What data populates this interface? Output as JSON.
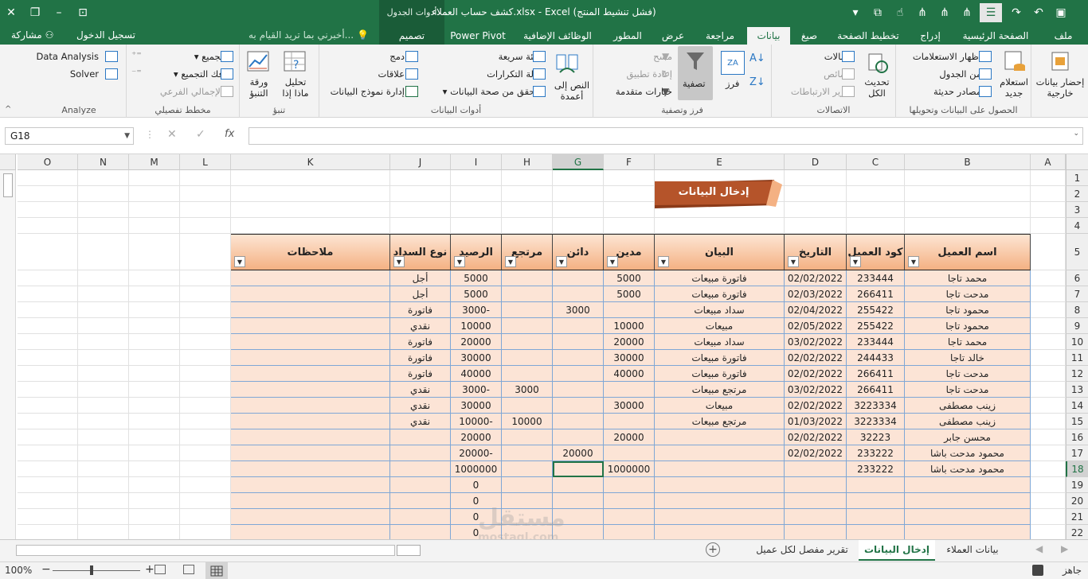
{
  "window": {
    "title": "كشف حساب العملاء.xlsx - Excel (فشل تنشيط المنتج)",
    "context_group_label": "أدوات الجدول"
  },
  "tabs": {
    "file": "ملف",
    "home": "الصفحة الرئيسية",
    "insert": "إدراج",
    "page_layout": "تخطيط الصفحة",
    "formulas": "صيغ",
    "data": "بيانات",
    "review": "مراجعة",
    "view": "عرض",
    "developer": "المطور",
    "addins": "الوظائف الإضافية",
    "power_pivot": "Power Pivot",
    "design": "تصميم",
    "tell_me": "أخبرني بما تريد القيام به...",
    "sign_in": "تسجيل الدخول",
    "share": "مشاركة"
  },
  "ribbon": {
    "get_external": "إحضار بيانات خارجية",
    "new_query": "استعلام جديد",
    "show_queries": "إظهار الاستعلامات",
    "from_table": "من الجدول",
    "recent_sources": "مصادر حديثة",
    "get_transform_label": "الحصول على البيانات وتحويلها",
    "refresh_all": "تحديث الكل",
    "connections": "اتصالات",
    "properties": "خصائص",
    "edit_links": "تحرير الارتباطات",
    "connections_label": "الاتصالات",
    "sort": "فرز",
    "filter": "تصفية",
    "clear": "مسح",
    "reapply": "إعادة تطبيق",
    "advanced": "خيارات متقدمة",
    "sort_filter_label": "فرز وتصفية",
    "text_to_columns": "النص إلى أعمدة",
    "flash_fill": "تعبئة سريعة",
    "remove_duplicates": "إزالة التكرارات",
    "data_validation": "التحقق من صحة البيانات",
    "consolidate": "دمج",
    "relationships": "علاقات",
    "manage_model": "إدارة نموذج البيانات",
    "data_tools_label": "أدوات البيانات",
    "what_if": "تحليل ماذا إذا",
    "forecast_sheet": "ورقة التنبؤ",
    "forecast_label": "تنبؤ",
    "group": "تجميع",
    "ungroup": "فك التجميع",
    "subtotal": "الإجمالي الفرعي",
    "outline_label": "مخطط تفصيلي",
    "data_analysis": "Data Analysis",
    "solver": "Solver",
    "analyze_label": "Analyze"
  },
  "formula_bar": {
    "name_box": "G18",
    "fx": "fx",
    "content": ""
  },
  "columns": [
    "O",
    "N",
    "M",
    "L",
    "K",
    "J",
    "I",
    "H",
    "G",
    "F",
    "E",
    "D",
    "C",
    "B",
    "A"
  ],
  "selected_column": "G",
  "rows": [
    "1",
    "2",
    "3",
    "4",
    "5",
    "6",
    "7",
    "8",
    "9",
    "10",
    "11",
    "12",
    "13",
    "14",
    "15",
    "16",
    "17",
    "18",
    "19",
    "20",
    "21",
    "22"
  ],
  "selected_row": "18",
  "banner": "إدخال البيانات",
  "table": {
    "headers": {
      "name": "اسم العميل",
      "code": "كود العميل",
      "date": "التاريخ",
      "desc": "البيان",
      "debit": "مدين",
      "credit": "دائن",
      "return": "مرتجع",
      "balance": "الرصيد",
      "pay_type": "نوع السداد",
      "notes": "ملاحظات"
    },
    "rows": [
      {
        "name": "محمد تاجا",
        "code": "233444",
        "date": "02/02/2022",
        "desc": "فاتورة مبيعات",
        "debit": "5000",
        "credit": "",
        "ret": "",
        "balance": "5000",
        "pay": "أجل",
        "notes": ""
      },
      {
        "name": "مدحت تاجا",
        "code": "266411",
        "date": "02/03/2022",
        "desc": "فاتورة مبيعات",
        "debit": "5000",
        "credit": "",
        "ret": "",
        "balance": "5000",
        "pay": "أجل",
        "notes": ""
      },
      {
        "name": "محمود تاجا",
        "code": "255422",
        "date": "02/04/2022",
        "desc": "سداد مبيعات",
        "debit": "",
        "credit": "3000",
        "ret": "",
        "balance": "3000-",
        "pay": "فاتورة",
        "notes": ""
      },
      {
        "name": "محمود تاجا",
        "code": "255422",
        "date": "02/05/2022",
        "desc": "مبيعات",
        "debit": "10000",
        "credit": "",
        "ret": "",
        "balance": "10000",
        "pay": "نقدي",
        "notes": ""
      },
      {
        "name": "محمد تاجا",
        "code": "233444",
        "date": "03/02/2022",
        "desc": "سداد مبيعات",
        "debit": "20000",
        "credit": "",
        "ret": "",
        "balance": "20000",
        "pay": "فاتورة",
        "notes": ""
      },
      {
        "name": "خالد تاجا",
        "code": "244433",
        "date": "02/02/2022",
        "desc": "فاتورة مبيعات",
        "debit": "30000",
        "credit": "",
        "ret": "",
        "balance": "30000",
        "pay": "فاتورة",
        "notes": ""
      },
      {
        "name": "مدحت تاجا",
        "code": "266411",
        "date": "02/02/2022",
        "desc": "فاتورة مبيعات",
        "debit": "40000",
        "credit": "",
        "ret": "",
        "balance": "40000",
        "pay": "فاتورة",
        "notes": ""
      },
      {
        "name": "مدحت تاجا",
        "code": "266411",
        "date": "03/02/2022",
        "desc": "مرتجع مبيعات",
        "debit": "",
        "credit": "",
        "ret": "3000",
        "balance": "3000-",
        "pay": "نقدي",
        "notes": ""
      },
      {
        "name": "زينب مصطفى",
        "code": "3223334",
        "date": "02/02/2022",
        "desc": "مبيعات",
        "debit": "30000",
        "credit": "",
        "ret": "",
        "balance": "30000",
        "pay": "نقدي",
        "notes": ""
      },
      {
        "name": "زينب مصطفى",
        "code": "3223334",
        "date": "01/03/2022",
        "desc": "مرتجع مبيعات",
        "debit": "",
        "credit": "",
        "ret": "10000",
        "balance": "10000-",
        "pay": "نقدي",
        "notes": ""
      },
      {
        "name": "محسن جابر",
        "code": "32223",
        "date": "02/02/2022",
        "desc": "",
        "debit": "20000",
        "credit": "",
        "ret": "",
        "balance": "20000",
        "pay": "",
        "notes": ""
      },
      {
        "name": "محمود مدحت باشا",
        "code": "233222",
        "date": "02/02/2022",
        "desc": "",
        "debit": "",
        "credit": "20000",
        "ret": "",
        "balance": "20000-",
        "pay": "",
        "notes": ""
      },
      {
        "name": "محمود مدحت باشا",
        "code": "233222",
        "date": "",
        "desc": "",
        "debit": "1000000",
        "credit": "",
        "ret": "",
        "balance": "1000000",
        "pay": "",
        "notes": ""
      },
      {
        "name": "",
        "code": "",
        "date": "",
        "desc": "",
        "debit": "",
        "credit": "",
        "ret": "",
        "balance": "0",
        "pay": "",
        "notes": ""
      },
      {
        "name": "",
        "code": "",
        "date": "",
        "desc": "",
        "debit": "",
        "credit": "",
        "ret": "",
        "balance": "0",
        "pay": "",
        "notes": ""
      },
      {
        "name": "",
        "code": "",
        "date": "",
        "desc": "",
        "debit": "",
        "credit": "",
        "ret": "",
        "balance": "0",
        "pay": "",
        "notes": ""
      },
      {
        "name": "",
        "code": "",
        "date": "",
        "desc": "",
        "debit": "",
        "credit": "",
        "ret": "",
        "balance": "0",
        "pay": "",
        "notes": ""
      }
    ]
  },
  "sheets": {
    "customers": "بيانات العملاء",
    "entry": "إدخال البيانات",
    "report": "تقرير مفصل لكل عميل"
  },
  "status": {
    "ready": "جاهز",
    "zoom": "100%"
  },
  "watermark": {
    "arabic": "مستقل",
    "latin": "mostaql.com"
  },
  "colors": {
    "excel_green": "#217346",
    "table_fill": "#fce4d6",
    "header_fill": "#f4b183",
    "banner": "#a0522d"
  }
}
